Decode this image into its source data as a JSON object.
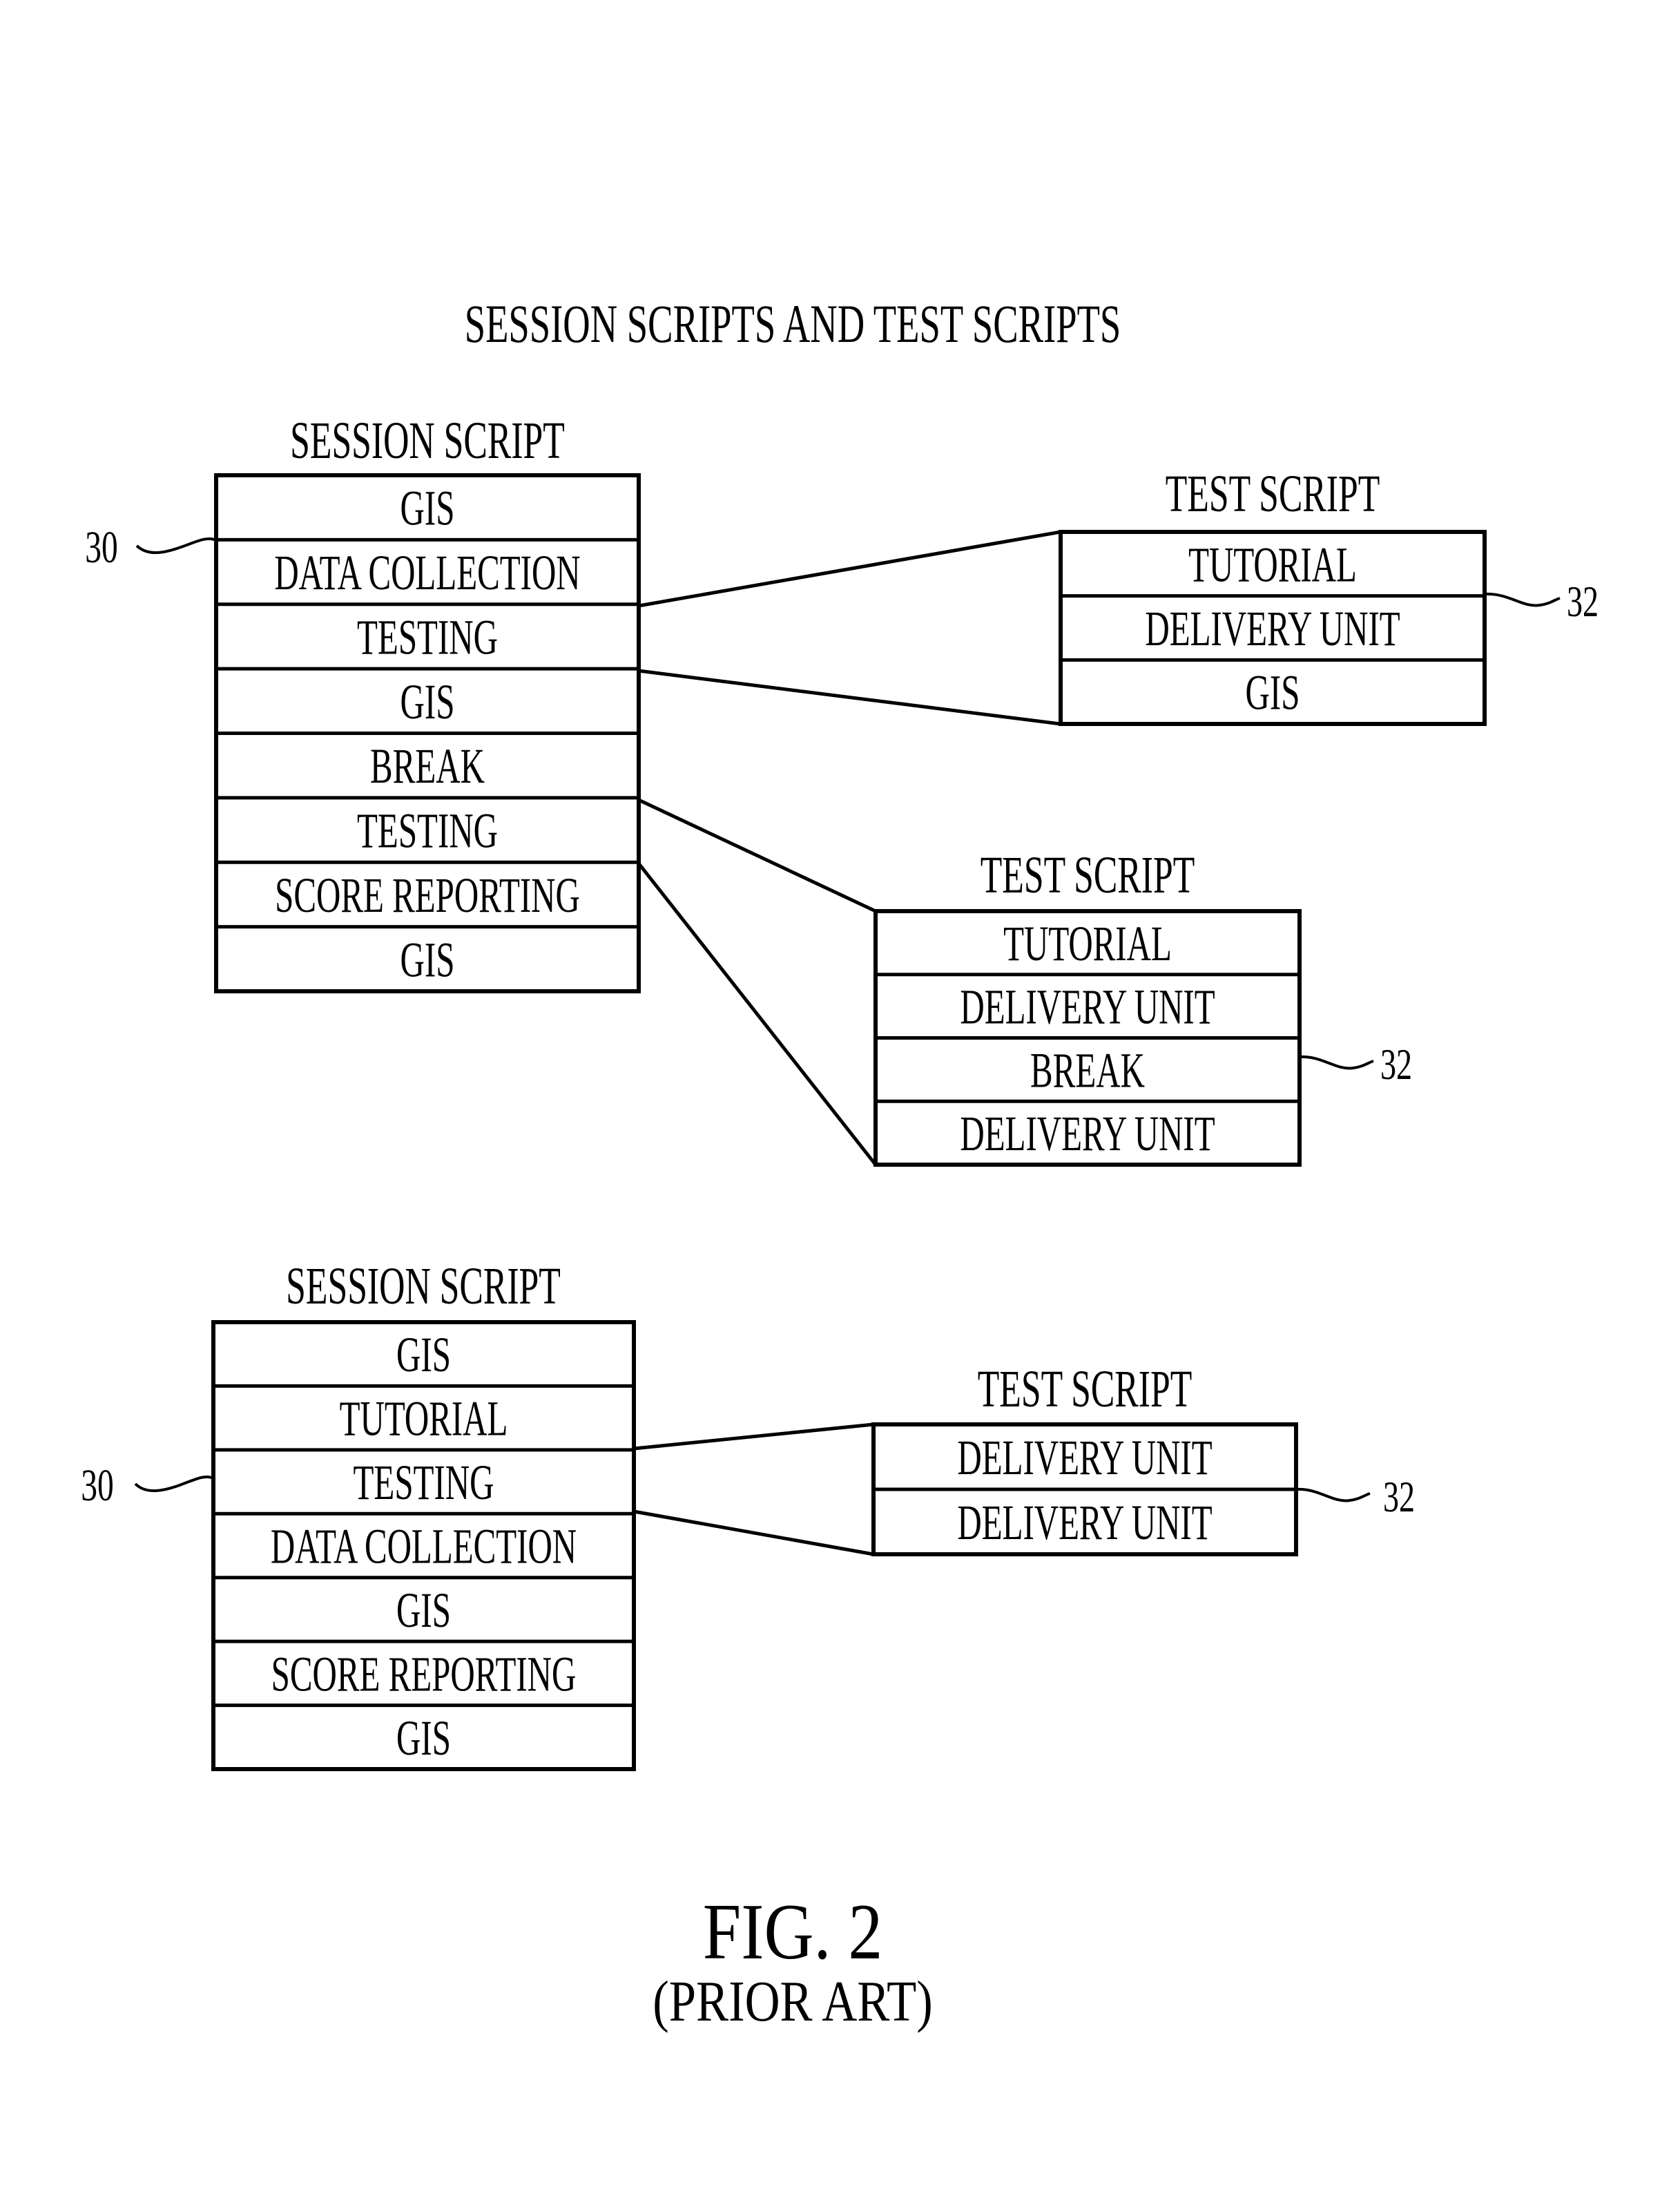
{
  "title": "SESSION SCRIPTS AND TEST SCRIPTS",
  "figure": {
    "label": "FIG. 2",
    "sublabel": "(PRIOR ART)"
  },
  "groups": [
    {
      "session_script": {
        "heading": "SESSION SCRIPT",
        "ref_numeral": "30",
        "rows": [
          "GIS",
          "DATA COLLECTION",
          "TESTING",
          "GIS",
          "BREAK",
          "TESTING",
          "SCORE REPORTING",
          "GIS"
        ]
      },
      "test_scripts": [
        {
          "heading": "TEST SCRIPT",
          "ref_numeral": "32",
          "linked_session_row": 2,
          "rows": [
            "TUTORIAL",
            "DELIVERY UNIT",
            "GIS"
          ]
        },
        {
          "heading": "TEST SCRIPT",
          "ref_numeral": "32",
          "linked_session_row": 5,
          "rows": [
            "TUTORIAL",
            "DELIVERY UNIT",
            "BREAK",
            "DELIVERY UNIT"
          ]
        }
      ]
    },
    {
      "session_script": {
        "heading": "SESSION SCRIPT",
        "ref_numeral": "30",
        "rows": [
          "GIS",
          "TUTORIAL",
          "TESTING",
          "DATA COLLECTION",
          "GIS",
          "SCORE REPORTING",
          "GIS"
        ]
      },
      "test_scripts": [
        {
          "heading": "TEST SCRIPT",
          "ref_numeral": "32",
          "linked_session_row": 2,
          "rows": [
            "DELIVERY UNIT",
            "DELIVERY UNIT"
          ]
        }
      ]
    }
  ]
}
